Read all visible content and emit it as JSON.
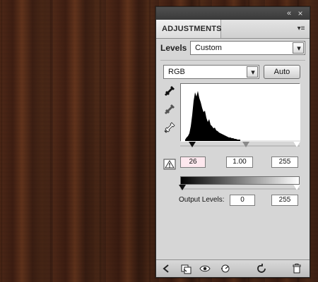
{
  "panel": {
    "tab_label": "ADJUSTMENTS",
    "top_icons": {
      "collapse": "«",
      "close": "×",
      "menu": "▾≡"
    }
  },
  "levels": {
    "label": "Levels",
    "preset_value": "Custom",
    "channel_value": "RGB",
    "auto_label": "Auto"
  },
  "input_levels": {
    "black": "26",
    "gamma": "1.00",
    "white": "255",
    "slider_positions_values": {
      "black": 26,
      "gamma": 1.0,
      "white": 255
    }
  },
  "output_levels": {
    "label": "Output Levels:",
    "black": "0",
    "white": "255"
  },
  "icons": {
    "eyedropper_black": "eyedropper-black-icon",
    "eyedropper_gray": "eyedropper-gray-icon",
    "eyedropper_white": "eyedropper-white-icon",
    "clipping_warning": "warning-icon",
    "bottom": [
      "back-icon",
      "clip-to-layer-icon",
      "visibility-icon",
      "view-previous-icon",
      "reset-icon",
      "delete-icon"
    ]
  },
  "histogram": {
    "shape": "dark-peaked"
  }
}
